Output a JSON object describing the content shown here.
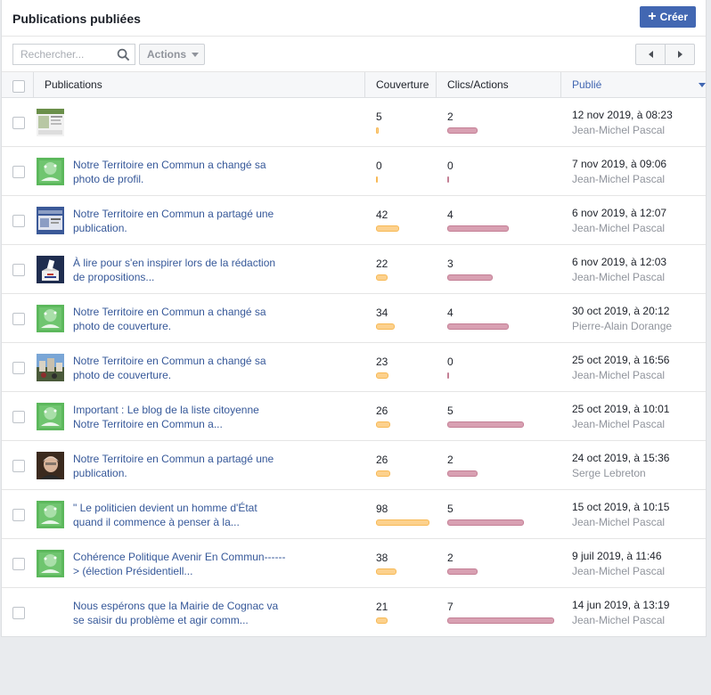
{
  "header": {
    "title": "Publications publiées",
    "create_label": "Créer"
  },
  "toolbar": {
    "search_placeholder": "Rechercher...",
    "actions_label": "Actions"
  },
  "columns": {
    "publications": "Publications",
    "reach": "Couverture",
    "clicks": "Clics/Actions",
    "published": "Publié"
  },
  "colors": {
    "accent": "#4267b2",
    "link": "#365899",
    "reach_bar": "#fcd18d",
    "clicks_bar": "#d8a0b2"
  },
  "rows": [
    {
      "text": "",
      "reach": "5",
      "clicks": "2",
      "date": "12 nov 2019, à 08:23",
      "author": "Jean-Michel Pascal",
      "thumb": "screenshot",
      "reach_fraction": 0.051,
      "clicks_fraction": 0.286
    },
    {
      "text": "Notre Territoire en Commun a changé sa photo de profil.",
      "reach": "0",
      "clicks": "0",
      "date": "7 nov 2019, à 09:06",
      "author": "Jean-Michel Pascal",
      "thumb": "green-logo",
      "reach_fraction": 0,
      "clicks_fraction": 0
    },
    {
      "text": "Notre Territoire en Commun a partagé une publication.",
      "reach": "42",
      "clicks": "4",
      "date": "6 nov 2019, à 12:07",
      "author": "Jean-Michel Pascal",
      "thumb": "blue-screen",
      "reach_fraction": 0.429,
      "clicks_fraction": 0.571
    },
    {
      "text": "À lire pour s'en inspirer lors de la rédaction de propositions...",
      "reach": "22",
      "clicks": "3",
      "date": "6 nov 2019, à 12:03",
      "author": "Jean-Michel Pascal",
      "thumb": "ballot-box",
      "reach_fraction": 0.224,
      "clicks_fraction": 0.429
    },
    {
      "text": "Notre Territoire en Commun a changé sa photo de couverture.",
      "reach": "34",
      "clicks": "4",
      "date": "30 oct 2019, à 20:12",
      "author": "Pierre-Alain Dorange",
      "thumb": "green-logo",
      "reach_fraction": 0.347,
      "clicks_fraction": 0.571
    },
    {
      "text": "Notre Territoire en Commun a changé sa photo de couverture.",
      "reach": "23",
      "clicks": "0",
      "date": "25 oct 2019, à 16:56",
      "author": "Jean-Michel Pascal",
      "thumb": "city-photo",
      "reach_fraction": 0.235,
      "clicks_fraction": 0
    },
    {
      "text": "Important : Le blog de la liste citoyenne Notre Territoire en Commun a...",
      "reach": "26",
      "clicks": "5",
      "date": "25 oct 2019, à 10:01",
      "author": "Jean-Michel Pascal",
      "thumb": "green-logo",
      "reach_fraction": 0.265,
      "clicks_fraction": 0.714
    },
    {
      "text": "Notre Territoire en Commun a partagé une publication.",
      "reach": "26",
      "clicks": "2",
      "date": "24 oct 2019, à 15:36",
      "author": "Serge Lebreton",
      "thumb": "portrait",
      "reach_fraction": 0.265,
      "clicks_fraction": 0.286
    },
    {
      "text": "\" Le politicien devient un homme d'État quand il commence à penser à la...",
      "reach": "98",
      "clicks": "5",
      "date": "15 oct 2019, à 10:15",
      "author": "Jean-Michel Pascal",
      "thumb": "green-logo",
      "reach_fraction": 1.0,
      "clicks_fraction": 0.714
    },
    {
      "text": "Cohérence Politique Avenir En Commun------> (élection Présidentiell...",
      "reach": "38",
      "clicks": "2",
      "date": "9 juil 2019, à 11:46",
      "author": "Jean-Michel Pascal",
      "thumb": "green-logo",
      "reach_fraction": 0.388,
      "clicks_fraction": 0.286
    },
    {
      "text": "Nous espérons que la Mairie de Cognac va se saisir du problème et agir comm...",
      "reach": "21",
      "clicks": "7",
      "date": "14 jun 2019, à 13:19",
      "author": "Jean-Michel Pascal",
      "thumb": "none",
      "reach_fraction": 0.214,
      "clicks_fraction": 1.0
    }
  ]
}
